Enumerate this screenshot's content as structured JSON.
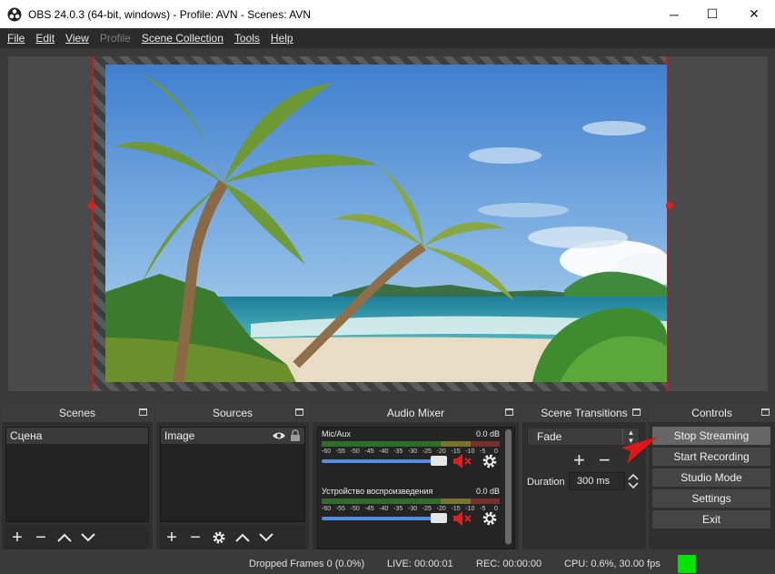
{
  "window": {
    "title": "OBS 24.0.3 (64-bit, windows) - Profile: AVN - Scenes: AVN",
    "minimize": "─",
    "maximize": "☐",
    "close": "✕"
  },
  "menu": [
    "File",
    "Edit",
    "View",
    "Profile",
    "Scene Collection",
    "Tools",
    "Help"
  ],
  "docks": {
    "scenes": {
      "title": "Scenes",
      "items": [
        "Сцена"
      ]
    },
    "sources": {
      "title": "Sources",
      "items": [
        "Image"
      ]
    },
    "mixer": {
      "title": "Audio Mixer",
      "channels": [
        {
          "name": "Mic/Aux",
          "db": "0.0 dB"
        },
        {
          "name": "Устройство воспроизведения",
          "db": "0.0 dB"
        }
      ],
      "scale": [
        "-60",
        "-55",
        "-50",
        "-45",
        "-40",
        "-35",
        "-30",
        "-25",
        "-20",
        "-15",
        "-10",
        "-5",
        "0"
      ]
    },
    "transitions": {
      "title": "Scene Transitions",
      "selected": "Fade",
      "duration_label": "Duration",
      "duration_value": "300 ms"
    },
    "controls": {
      "title": "Controls",
      "buttons": [
        "Stop Streaming",
        "Start Recording",
        "Studio Mode",
        "Settings",
        "Exit"
      ]
    }
  },
  "status": {
    "dropped": "Dropped Frames 0 (0.0%)",
    "live": "LIVE: 00:00:01",
    "rec": "REC: 00:00:00",
    "cpu": "CPU: 0.6%, 30.00 fps"
  },
  "colors": {
    "stream_indicator": "#00e500",
    "selection_border": "#d01818"
  }
}
